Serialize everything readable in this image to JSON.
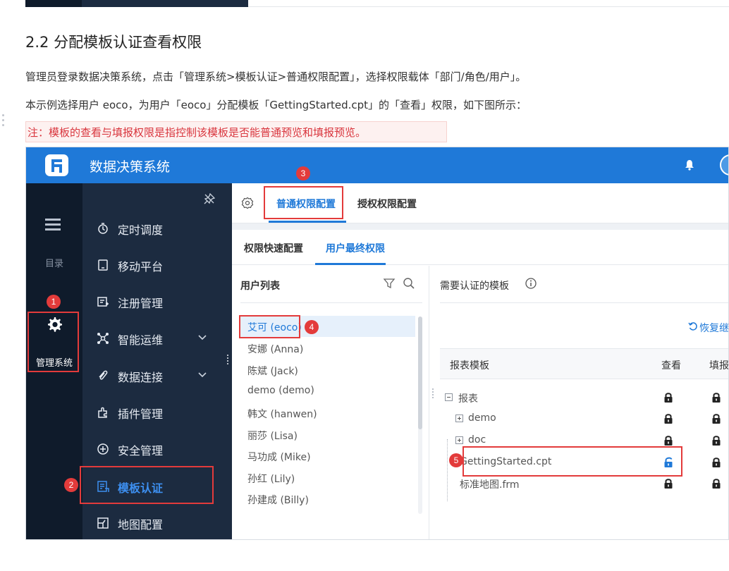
{
  "doc": {
    "heading": "2.2 分配模板认证查看权限",
    "para1": "管理员登录数据决策系统，点击「管理系统>模板认证>普通权限配置」，选择权限载体「部门/角色/用户」。",
    "para2": "本示例选择用户 eoco，为用户「eoco」分配模板「GettingStarted.cpt」的「查看」权限，如下图所示：",
    "note": "注：模板的查看与填报权限是指控制该模板是否能普通预览和填报预览。"
  },
  "app": {
    "title": "数据决策系统",
    "accent": "#1f79d8",
    "annotation_color": "#e33b3b"
  },
  "rail": {
    "catalog_label": "目录",
    "admin_label": "管理系统"
  },
  "menu": [
    {
      "label": "定时调度",
      "icon": "timer-icon"
    },
    {
      "label": "移动平台",
      "icon": "tablet-icon"
    },
    {
      "label": "注册管理",
      "icon": "register-icon"
    },
    {
      "label": "智能运维",
      "icon": "ops-icon",
      "expandable": true
    },
    {
      "label": "数据连接",
      "icon": "link-icon",
      "expandable": true
    },
    {
      "label": "插件管理",
      "icon": "plugin-icon"
    },
    {
      "label": "安全管理",
      "icon": "shield-icon"
    },
    {
      "label": "模板认证",
      "icon": "template-icon",
      "active": true
    },
    {
      "label": "地图配置",
      "icon": "map-icon"
    }
  ],
  "tabs": {
    "common": "普通权限配置",
    "grant": "授权权限配置"
  },
  "subtabs": {
    "quick": "权限快速配置",
    "final": "用户最终权限"
  },
  "users": {
    "title": "用户列表",
    "items": [
      "艾可 (eoco)",
      "安娜 (Anna)",
      "陈斌 (Jack)",
      "demo (demo)",
      "韩文 (hanwen)",
      "丽莎 (Lisa)",
      "马功成 (Mike)",
      "孙红 (Lily)",
      "孙建成 (Billy)"
    ]
  },
  "templates": {
    "title": "需要认证的模板",
    "restore": "恢复继",
    "col_name": "报表模板",
    "col_view": "查看",
    "col_fill": "填报",
    "rows": [
      {
        "label": "报表",
        "type": "folder-open"
      },
      {
        "label": "demo",
        "type": "folder"
      },
      {
        "label": "doc",
        "type": "folder"
      },
      {
        "label": "GettingStarted.cpt",
        "type": "file",
        "view_unlocked": true
      },
      {
        "label": "标准地图.frm",
        "type": "file"
      }
    ]
  },
  "badges": [
    "1",
    "2",
    "3",
    "4",
    "5"
  ]
}
